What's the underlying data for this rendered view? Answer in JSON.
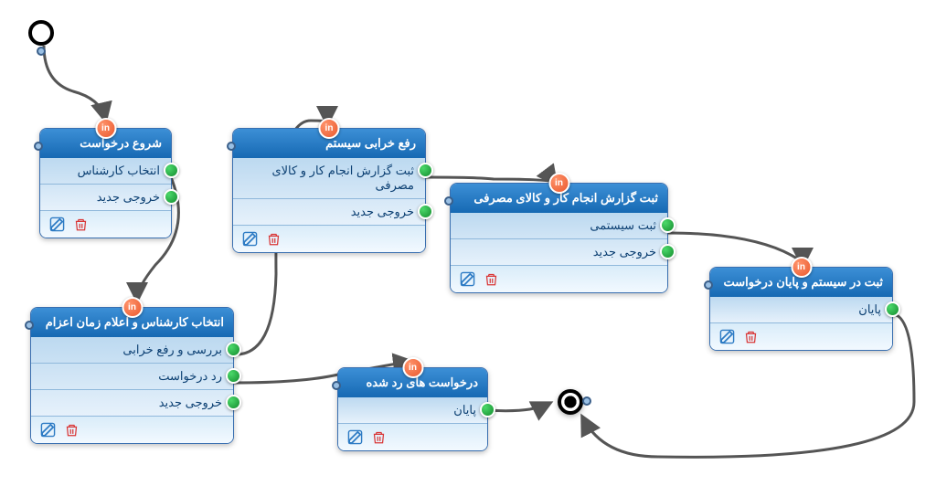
{
  "start_label": "in",
  "nodes": {
    "start_request": {
      "title": "شروع درخواست",
      "items": [
        "انتخاب کارشناس",
        "خروجی جدید"
      ]
    },
    "fix_system": {
      "title": "رفع خرابی سیستم",
      "items": [
        "ثبت گزارش انجام کار و کالای مصرفی",
        "خروجی جدید"
      ]
    },
    "register_report": {
      "title": "ثبت گزارش انجام کار و کالای مصرفی",
      "items": [
        "ثبت سیستمی",
        "خروجی جدید"
      ]
    },
    "select_expert": {
      "title": "انتخاب کارشناس و اعلام زمان اعزام",
      "items": [
        "بررسی و رفع خرابی",
        "رد درخواست",
        "خروجی جدید"
      ]
    },
    "rejected": {
      "title": "درخواست های رد شده",
      "items": [
        "پایان"
      ]
    },
    "finalize": {
      "title": "ثبت در سیستم و پایان درخواست",
      "items": [
        "پایان"
      ]
    }
  },
  "icons": {
    "edit": "edit-icon",
    "trash": "trash-icon"
  }
}
